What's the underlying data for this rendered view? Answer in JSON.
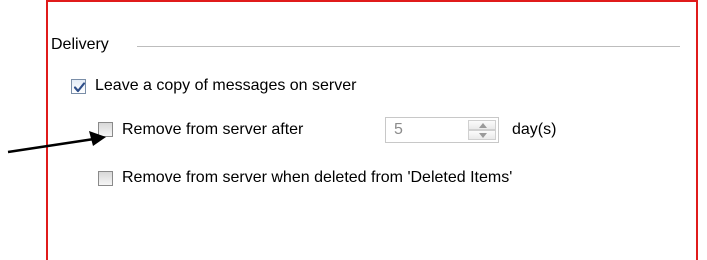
{
  "delivery": {
    "group_label": "Delivery",
    "leave_copy": {
      "label": "Leave a copy of messages on server",
      "checked": true
    },
    "remove_after": {
      "label": "Remove from server after",
      "checked": false,
      "days_value": "5",
      "unit_label": "day(s)"
    },
    "remove_deleted": {
      "label": "Remove from server when deleted from 'Deleted Items'",
      "checked": false
    }
  },
  "colors": {
    "frame_border": "#e01b1b",
    "check_mark": "#2f4f8a"
  }
}
